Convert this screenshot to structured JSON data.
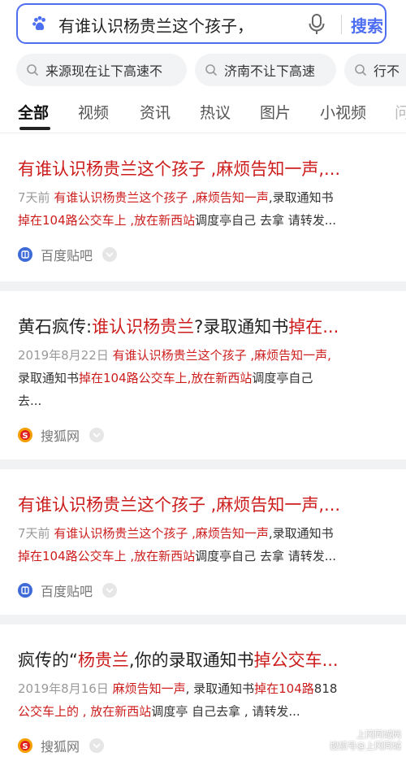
{
  "search": {
    "query": "有谁认识杨贵兰这个孩子，",
    "button_label": "搜索"
  },
  "suggestions": [
    {
      "label": "来源现在让下高速不"
    },
    {
      "label": "济南不让下高速"
    },
    {
      "label": "行不"
    }
  ],
  "tabs": [
    {
      "label": "全部",
      "active": true
    },
    {
      "label": "视频"
    },
    {
      "label": "资讯"
    },
    {
      "label": "热议"
    },
    {
      "label": "图片"
    },
    {
      "label": "小视频"
    },
    {
      "label": "问"
    }
  ],
  "results": [
    {
      "title": [
        {
          "t": "有谁认识杨贵兰这个孩子 ,麻烦告知一声,...",
          "red": true
        }
      ],
      "lines": [
        [
          {
            "t": "7天前 ",
            "c": "date"
          },
          {
            "t": "有谁认识杨贵兰这个孩子 ,麻烦告知一声",
            "c": "red"
          },
          {
            "t": ",录取通知书",
            "c": ""
          }
        ],
        [
          {
            "t": "掉在104路公交车上 ,放在新西站",
            "c": "red"
          },
          {
            "t": "调度亭自己 去拿 请转发...",
            "c": ""
          }
        ]
      ],
      "source": "百度贴吧",
      "source_icon": "baidu-tieba-logo"
    },
    {
      "title": [
        {
          "t": "黄石疯传:",
          "red": false
        },
        {
          "t": "谁认识杨贵兰",
          "red": true
        },
        {
          "t": "?录取通知书",
          "red": false
        },
        {
          "t": "掉在...",
          "red": true
        }
      ],
      "lines": [
        [
          {
            "t": "2019年8月22日 ",
            "c": "date"
          },
          {
            "t": "有谁认识杨贵兰这个孩子 ,麻烦告知一声,",
            "c": "red"
          }
        ],
        [
          {
            "t": "录取通知书",
            "c": ""
          },
          {
            "t": "掉在104路公交车上,放在新西站",
            "c": "red"
          },
          {
            "t": "调度亭自己",
            "c": ""
          }
        ],
        [
          {
            "t": "去...",
            "c": ""
          }
        ]
      ],
      "source": "搜狐网",
      "source_icon": "sohu-logo"
    },
    {
      "title": [
        {
          "t": "有谁认识杨贵兰这个孩子 ,麻烦告知一声,...",
          "red": true
        }
      ],
      "lines": [
        [
          {
            "t": "7天前 ",
            "c": "date"
          },
          {
            "t": "有谁认识杨贵兰这个孩子 ,麻烦告知一声",
            "c": "red"
          },
          {
            "t": ",录取通知书",
            "c": ""
          }
        ],
        [
          {
            "t": "掉在104路公交车上 ,放在新西站",
            "c": "red"
          },
          {
            "t": "调度亭自己 去拿 请转发...",
            "c": ""
          }
        ]
      ],
      "source": "百度贴吧",
      "source_icon": "baidu-tieba-logo"
    },
    {
      "title": [
        {
          "t": "疯传的“",
          "red": false
        },
        {
          "t": "杨贵兰",
          "red": true
        },
        {
          "t": ",你的录取通知书",
          "red": false
        },
        {
          "t": "掉公交车...",
          "red": true
        }
      ],
      "lines": [
        [
          {
            "t": "2019年8月16日 ",
            "c": "date"
          },
          {
            "t": "麻烦告知一声",
            "c": "red"
          },
          {
            "t": ", 录取通知书",
            "c": ""
          },
          {
            "t": "掉在104路",
            "c": "red"
          },
          {
            "t": "818",
            "c": ""
          }
        ],
        [
          {
            "t": "公交车上的 , 放在新西站",
            "c": "red"
          },
          {
            "t": "调度亭 自己去拿 , 请转发...",
            "c": ""
          }
        ]
      ],
      "source": "搜狐网",
      "source_icon": "sohu-logo"
    }
  ],
  "watermark": {
    "line1": "上冈同城网",
    "line2": "搜狐号@上冈同城"
  },
  "colors": {
    "accent": "#4e6ef2",
    "highlight": "#cc1c1c"
  }
}
